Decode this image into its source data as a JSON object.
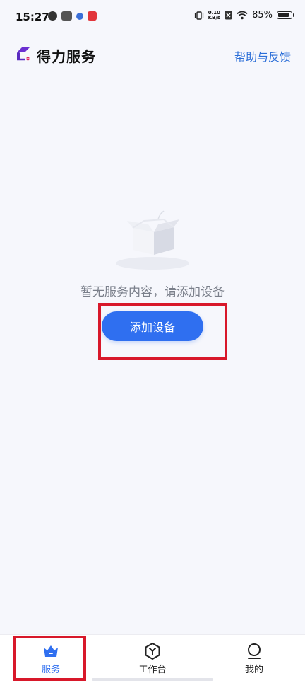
{
  "status_bar": {
    "time": "15:27",
    "net_speed_value": "0.10",
    "net_speed_unit": "KB/s",
    "battery": "85%"
  },
  "header": {
    "title": "得力服务",
    "help": "帮助与反馈"
  },
  "empty_state": {
    "message": "暂无服务内容，请添加设备",
    "button": "添加设备"
  },
  "tabs": [
    {
      "label": "服务",
      "icon": "crown-icon",
      "active": true
    },
    {
      "label": "工作台",
      "icon": "hexagon-y-icon",
      "active": false
    },
    {
      "label": "我的",
      "icon": "person-icon",
      "active": false
    }
  ],
  "colors": {
    "accent": "#2f6ff0",
    "link": "#2c6fd8",
    "highlight": "#d8182a",
    "background": "#f6f7fc"
  }
}
